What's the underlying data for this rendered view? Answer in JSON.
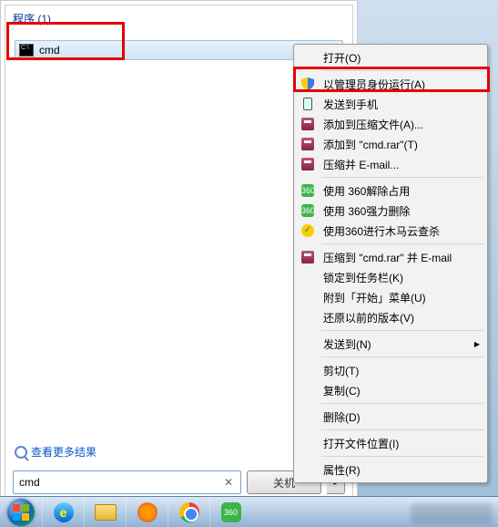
{
  "start_menu": {
    "section_header": "程序 (1)",
    "program": {
      "label": "cmd"
    },
    "see_more": "查看更多结果",
    "search_value": "cmd",
    "shutdown_label": "关机"
  },
  "context_menu": {
    "items": [
      {
        "label": "打开(O)",
        "icon": null,
        "sub": false
      },
      {
        "sep": true
      },
      {
        "label": "以管理员身份运行(A)",
        "icon": "shield",
        "sub": false,
        "highlight": true
      },
      {
        "label": "发送到手机",
        "icon": "phone",
        "sub": false
      },
      {
        "label": "添加到压缩文件(A)...",
        "icon": "rar",
        "sub": false
      },
      {
        "label": "添加到 \"cmd.rar\"(T)",
        "icon": "rar",
        "sub": false
      },
      {
        "label": "压缩并 E-mail...",
        "icon": "rar",
        "sub": false
      },
      {
        "sep": true
      },
      {
        "label": "使用 360解除占用",
        "icon": "q360",
        "sub": false
      },
      {
        "label": "使用 360强力删除",
        "icon": "q360",
        "sub": false
      },
      {
        "label": "使用360进行木马云查杀",
        "icon": "q360y",
        "sub": false
      },
      {
        "sep": true
      },
      {
        "label": "压缩到 \"cmd.rar\" 并 E-mail",
        "icon": "rar",
        "sub": false
      },
      {
        "label": "锁定到任务栏(K)",
        "icon": null,
        "sub": false
      },
      {
        "label": "附到「开始」菜单(U)",
        "icon": null,
        "sub": false
      },
      {
        "label": "还原以前的版本(V)",
        "icon": null,
        "sub": false
      },
      {
        "sep": true
      },
      {
        "label": "发送到(N)",
        "icon": null,
        "sub": true
      },
      {
        "sep": true
      },
      {
        "label": "剪切(T)",
        "icon": null,
        "sub": false
      },
      {
        "label": "复制(C)",
        "icon": null,
        "sub": false
      },
      {
        "sep": true
      },
      {
        "label": "删除(D)",
        "icon": null,
        "sub": false
      },
      {
        "sep": true
      },
      {
        "label": "打开文件位置(I)",
        "icon": null,
        "sub": false
      },
      {
        "sep": true
      },
      {
        "label": "属性(R)",
        "icon": null,
        "sub": false
      }
    ]
  },
  "taskbar": {
    "items": [
      "start",
      "ie",
      "explorer",
      "firefox",
      "chrome",
      "360"
    ]
  }
}
